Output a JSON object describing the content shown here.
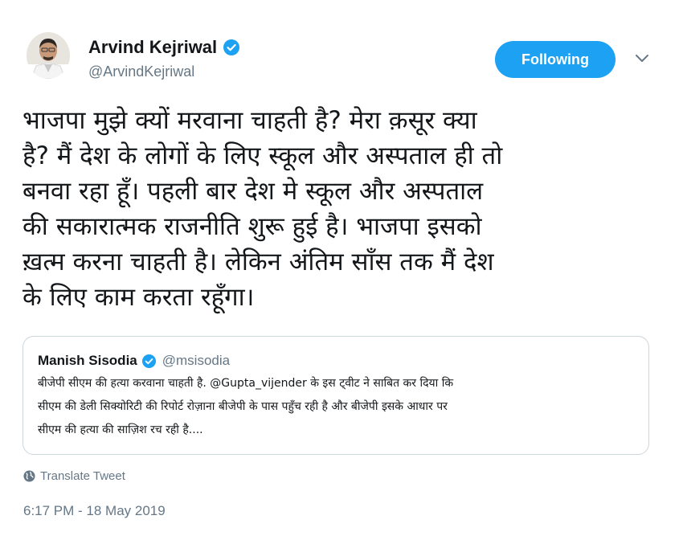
{
  "author": {
    "name": "Arvind Kejriwal",
    "handle": "@ArvindKejriwal",
    "verified": true
  },
  "follow_button": {
    "label": "Following",
    "color": "#1da1f2"
  },
  "tweet": {
    "lines": [
      "भाजपा मुझे क्यों मरवाना चाहती है? मेरा क़सूर क्या",
      "है? मैं देश के लोगों के लिए स्कूल और अस्पताल ही तो",
      "बनवा रहा हूँ। पहली बार देश मे स्कूल और अस्पताल",
      "की सकारात्मक राजनीति शुरू हुई है। भाजपा इसको",
      "ख़त्म करना चाहती है। लेकिन अंतिम साँस तक मैं देश",
      "के लिए काम करता रहूँगा।"
    ]
  },
  "quoted_tweet": {
    "name": "Manish Sisodia",
    "handle": "@msisodia",
    "verified": true,
    "lines": [
      "बीजेपी सीएम की हत्या करवाना चाहती है. @Gupta_vijender के इस ट्वीट ने साबित कर दिया कि",
      "सीएम की डेली सिक्योरिटी की रिपोर्ट रोज़ाना बीजेपी के पास पहुँच रही है और बीजेपी इसके आधार पर",
      "सीएम की हत्या की साज़िश रच रही है...."
    ]
  },
  "translate": {
    "label": "Translate Tweet",
    "icon": "globe-icon"
  },
  "timestamp": "6:17 PM - 18 May 2019",
  "colors": {
    "verified": "#1da1f2",
    "secondary_text": "#657786",
    "border": "#ccd6dd"
  }
}
